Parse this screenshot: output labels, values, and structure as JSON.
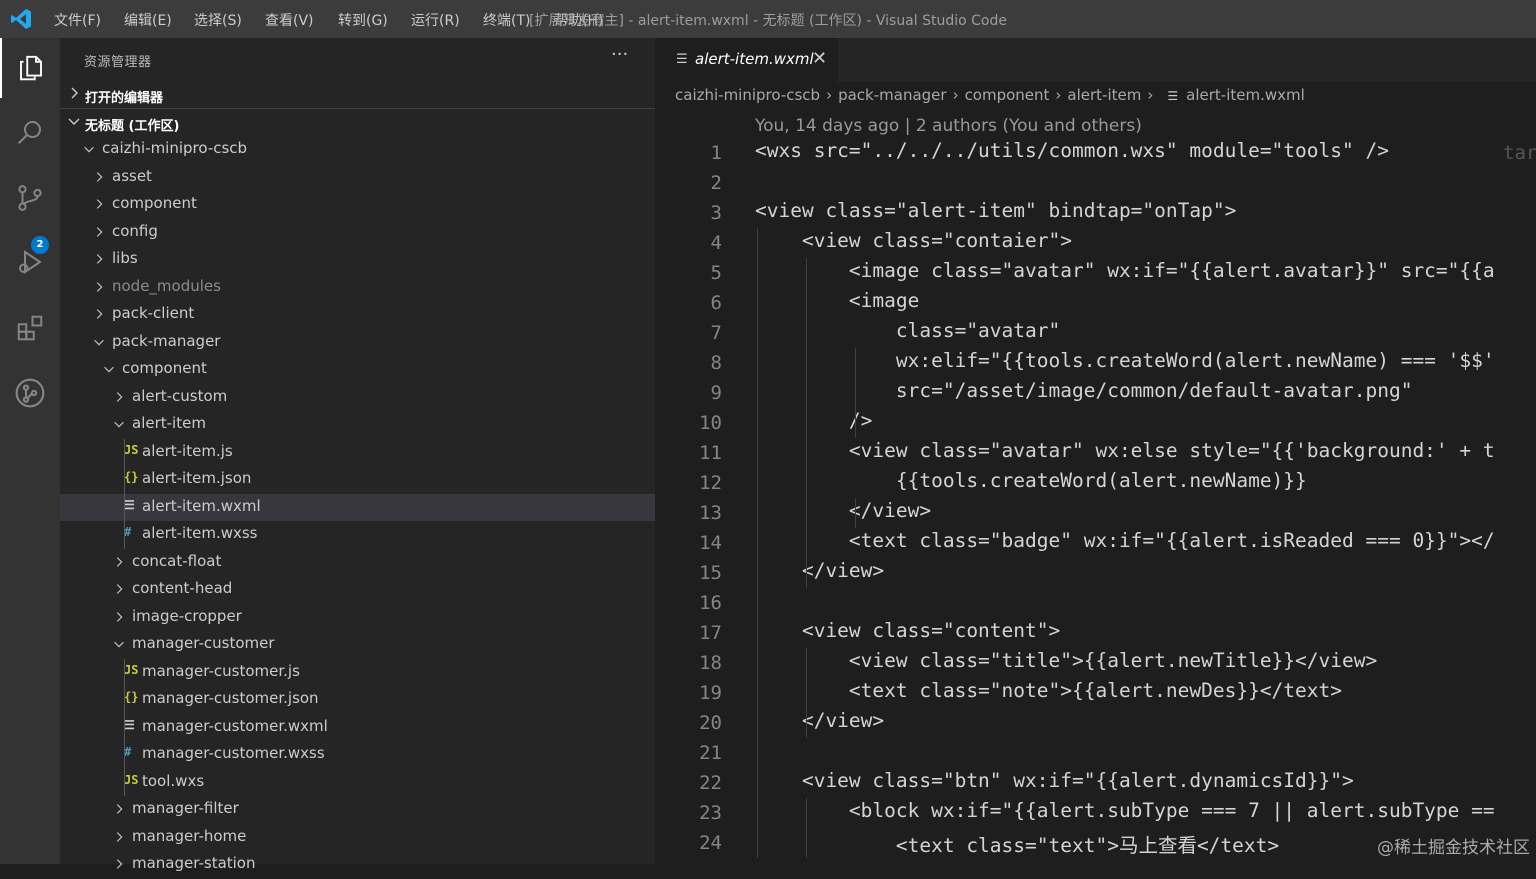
{
  "titlebar": {
    "menu": [
      "文件(F)",
      "编辑(E)",
      "选择(S)",
      "查看(V)",
      "转到(G)",
      "运行(R)",
      "终端(T)",
      "帮助(H)"
    ],
    "window_title": "[扩展开发宿主] - alert-item.wxml - 无标题 (工作区) - Visual Studio Code",
    "accent_color": "#007acc"
  },
  "activitybar": {
    "icons": [
      "explorer-icon",
      "search-icon",
      "source-control-icon",
      "run-debug-icon",
      "extensions-icon",
      "git-graph-icon"
    ],
    "scm_badge": "2"
  },
  "sidebar": {
    "title": "资源管理器",
    "more": "···",
    "open_editors_label": "打开的编辑器",
    "workspace_label": "无标题 (工作区)",
    "tree": [
      {
        "label": "caizhi-minipro-cscb",
        "type": "folder",
        "open": true
      },
      {
        "label": "asset",
        "type": "folder",
        "open": false
      },
      {
        "label": "component",
        "type": "folder",
        "open": false
      },
      {
        "label": "config",
        "type": "folder",
        "open": false
      },
      {
        "label": "libs",
        "type": "folder",
        "open": false
      },
      {
        "label": "node_modules",
        "type": "folder",
        "open": false,
        "dim": true
      },
      {
        "label": "pack-client",
        "type": "folder",
        "open": false
      },
      {
        "label": "pack-manager",
        "type": "folder",
        "open": true
      },
      {
        "label": "component",
        "type": "folder",
        "open": true
      },
      {
        "label": "alert-custom",
        "type": "folder",
        "open": false
      },
      {
        "label": "alert-item",
        "type": "folder",
        "open": true
      },
      {
        "label": "alert-item.js",
        "type": "js"
      },
      {
        "label": "alert-item.json",
        "type": "json"
      },
      {
        "label": "alert-item.wxml",
        "type": "wxml",
        "selected": true
      },
      {
        "label": "alert-item.wxss",
        "type": "wxss"
      },
      {
        "label": "concat-float",
        "type": "folder",
        "open": false
      },
      {
        "label": "content-head",
        "type": "folder",
        "open": false
      },
      {
        "label": "image-cropper",
        "type": "folder",
        "open": false
      },
      {
        "label": "manager-customer",
        "type": "folder",
        "open": true
      },
      {
        "label": "manager-customer.js",
        "type": "js"
      },
      {
        "label": "manager-customer.json",
        "type": "json"
      },
      {
        "label": "manager-customer.wxml",
        "type": "wxml"
      },
      {
        "label": "manager-customer.wxss",
        "type": "wxss"
      },
      {
        "label": "tool.wxs",
        "type": "js"
      },
      {
        "label": "manager-filter",
        "type": "folder",
        "open": false
      },
      {
        "label": "manager-home",
        "type": "folder",
        "open": false
      },
      {
        "label": "manager-station",
        "type": "folder",
        "open": false
      }
    ]
  },
  "editor": {
    "tab_label": "alert-item.wxml",
    "breadcrumb": [
      "caizhi-minipro-cscb",
      "pack-manager",
      "component",
      "alert-item",
      "alert-item.wxml"
    ],
    "codelens": "You, 14 days ago | 2 authors (You and others)",
    "blame": "tar",
    "lines": [
      "<wxs src=\"../../../utils/common.wxs\" module=\"tools\" />",
      "",
      "<view class=\"alert-item\" bindtap=\"onTap\">",
      "    <view class=\"contaier\">",
      "        <image class=\"avatar\" wx:if=\"{{alert.avatar}}\" src=\"{{a",
      "        <image",
      "            class=\"avatar\"",
      "            wx:elif=\"{{tools.createWord(alert.newName) === '$$'",
      "            src=\"/asset/image/common/default-avatar.png\"",
      "        />",
      "        <view class=\"avatar\" wx:else style=\"{{'background:' + t",
      "            {{tools.createWord(alert.newName)}}",
      "        </view>",
      "        <text class=\"badge\" wx:if=\"{{alert.isReaded === 0}}\"></",
      "    </view>",
      "",
      "    <view class=\"content\">",
      "        <view class=\"title\">{{alert.newTitle}}</view>",
      "        <text class=\"note\">{{alert.newDes}}</text>",
      "    </view>",
      "",
      "    <view class=\"btn\" wx:if=\"{{alert.dynamicsId}}\">",
      "        <block wx:if=\"{{alert.subType === 7 || alert.subType ==",
      "            <text class=\"text\">马上查看</text>"
    ],
    "line_numbers": [
      "1",
      "2",
      "3",
      "4",
      "5",
      "6",
      "7",
      "8",
      "9",
      "10",
      "11",
      "12",
      "13",
      "14",
      "15",
      "16",
      "17",
      "18",
      "19",
      "20",
      "21",
      "22",
      "23",
      "24"
    ]
  },
  "watermark": "@稀土掘金技术社区"
}
